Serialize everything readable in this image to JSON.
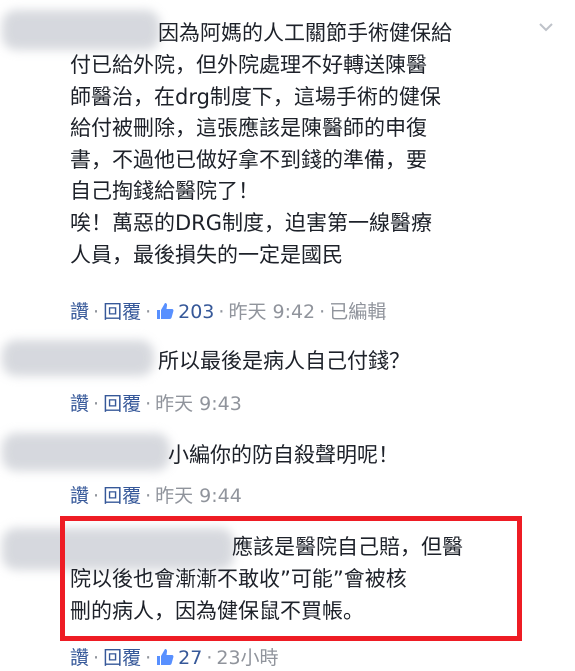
{
  "colors": {
    "text": "#1d2129",
    "link": "#365899",
    "meta": "#90949c",
    "highlight": "#ee1c24"
  },
  "comments": [
    {
      "lines": [
        "因為阿媽的人工關節手術健保給",
        "付已給外院，但外院處理不好轉送陳醫",
        "師醫治，在drg制度下，這場手術的健保",
        "給付被刪除，這張應該是陳醫師的申復",
        "書，不過他已做好拿不到錢的準備，要",
        "自己掏錢給醫院了！",
        "唉！萬惡的DRG制度，迫害第一線醫療",
        "人員，最後損失的一定是國民"
      ],
      "like_label": "讚",
      "reply_label": "回覆",
      "like_count": "203",
      "time": "昨天 9:42",
      "edited": "已編輯"
    },
    {
      "lines": [
        "所以最後是病人自己付錢？"
      ],
      "like_label": "讚",
      "reply_label": "回覆",
      "time": "昨天 9:43"
    },
    {
      "lines": [
        "小編你的防自殺聲明呢！"
      ],
      "like_label": "讚",
      "reply_label": "回覆",
      "time": "昨天 9:44"
    },
    {
      "lines": [
        "應該是醫院自己賠，但醫",
        "院以後也會漸漸不敢收”可能”會被核",
        "刪的病人，因為健保鼠不買帳。"
      ],
      "like_label": "讚",
      "reply_label": "回覆",
      "like_count": "27",
      "time": "23小時"
    }
  ]
}
